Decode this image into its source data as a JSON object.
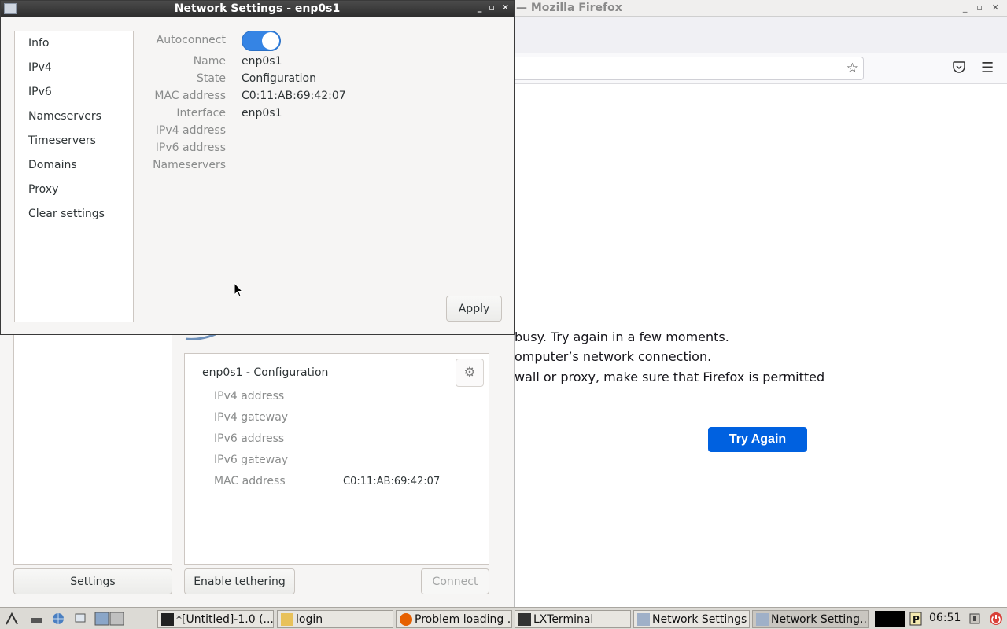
{
  "firefox": {
    "title": "— Mozilla Firefox",
    "error_lines": [
      "busy. Try again in a few moments.",
      "omputer’s network connection.",
      "wall or proxy, make sure that Firefox is permitted"
    ],
    "try_again_label": "Try Again"
  },
  "network_main": {
    "card_title": "enp0s1 - Configuration",
    "rows": [
      {
        "label": "IPv4 address",
        "value": ""
      },
      {
        "label": "IPv4 gateway",
        "value": ""
      },
      {
        "label": "IPv6 address",
        "value": ""
      },
      {
        "label": "IPv6 gateway",
        "value": ""
      },
      {
        "label": "MAC address",
        "value": "C0:11:AB:69:42:07"
      }
    ],
    "settings_label": "Settings",
    "tethering_label": "Enable tethering",
    "connect_label": "Connect"
  },
  "dialog": {
    "title": "Network Settings - enp0s1",
    "sidebar": [
      "Info",
      "IPv4",
      "IPv6",
      "Nameservers",
      "Timeservers",
      "Domains",
      "Proxy",
      "Clear settings"
    ],
    "autoconnect_label": "Autoconnect",
    "autoconnect_on": true,
    "fields": [
      {
        "label": "Name",
        "value": "enp0s1"
      },
      {
        "label": "State",
        "value": "Configuration"
      },
      {
        "label": "MAC address",
        "value": "C0:11:AB:69:42:07"
      },
      {
        "label": "Interface",
        "value": "enp0s1"
      },
      {
        "label": "IPv4 address",
        "value": ""
      },
      {
        "label": "IPv6 address",
        "value": ""
      },
      {
        "label": "Nameservers",
        "value": ""
      }
    ],
    "apply_label": "Apply"
  },
  "taskbar": {
    "tasks": [
      "*[Untitled]-1.0 (...",
      "login",
      "Problem loading ...",
      "LXTerminal",
      "Network Settings",
      "Network Setting..."
    ],
    "clock": "06:51"
  },
  "colors": {
    "accent": "#3584e4",
    "firefox_button": "#0061e0"
  }
}
